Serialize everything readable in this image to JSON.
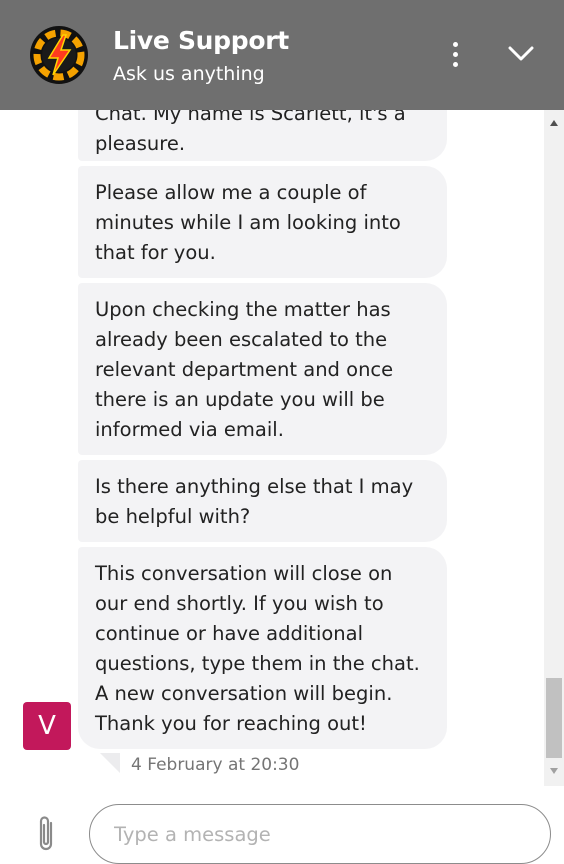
{
  "header": {
    "title": "Live Support",
    "subtitle": "Ask us anything",
    "logo_icon": "lightning-bolt-coin-icon",
    "menu_icon": "vertical-dots-icon",
    "collapse_icon": "chevron-down-icon",
    "background_color": "#6f6f6f"
  },
  "messages": [
    {
      "text": "Chat. My name is Scarlett, it's a pleasure."
    },
    {
      "text": "Please allow me a couple of minutes while I am looking into that for you."
    },
    {
      "text": "Upon checking the matter has already been escalated to the relevant department and once there is an update you will be informed via email."
    },
    {
      "text": "Is there anything else that I may be helpful with?"
    },
    {
      "text": "This conversation will close on our end shortly. If you wish to continue or have additional questions, type them in the chat. A new conversation will begin. Thank you for reaching out!"
    }
  ],
  "agent": {
    "avatar_initial": "V",
    "avatar_color": "#c2185b"
  },
  "timestamp": "4 February at 20:30",
  "composer": {
    "placeholder": "Type a message",
    "value": "",
    "attach_icon": "paperclip-icon"
  }
}
